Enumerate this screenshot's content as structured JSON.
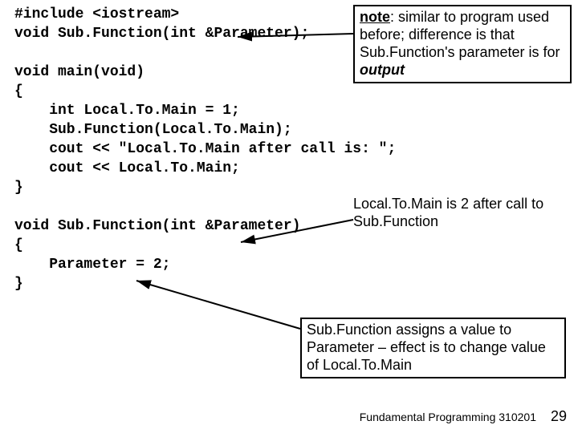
{
  "code": {
    "l1": "#include <iostream>",
    "l2": "void Sub.Function(int &Parameter);",
    "l3": "",
    "l4": "void main(void)",
    "l5": "{",
    "l6": "    int Local.To.Main = 1;",
    "l7": "    Sub.Function(Local.To.Main);",
    "l8": "    cout << \"Local.To.Main after call is: \";",
    "l9": "    cout << Local.To.Main;",
    "l10": "}",
    "l11": "",
    "l12": "void Sub.Function(int &Parameter)",
    "l13": "{",
    "l14": "    Parameter = 2;",
    "l15": "}"
  },
  "note1": {
    "label": "note",
    "rest1": ": similar to program used before; difference is that Sub.Function's parameter is for ",
    "out": "output"
  },
  "note2": "Local.To.Main is 2 after call to Sub.Function",
  "note3": "Sub.Function assigns a value to Parameter – effect is to change value of Local.To.Main",
  "footer": "Fundamental Programming 310201",
  "page": "29"
}
